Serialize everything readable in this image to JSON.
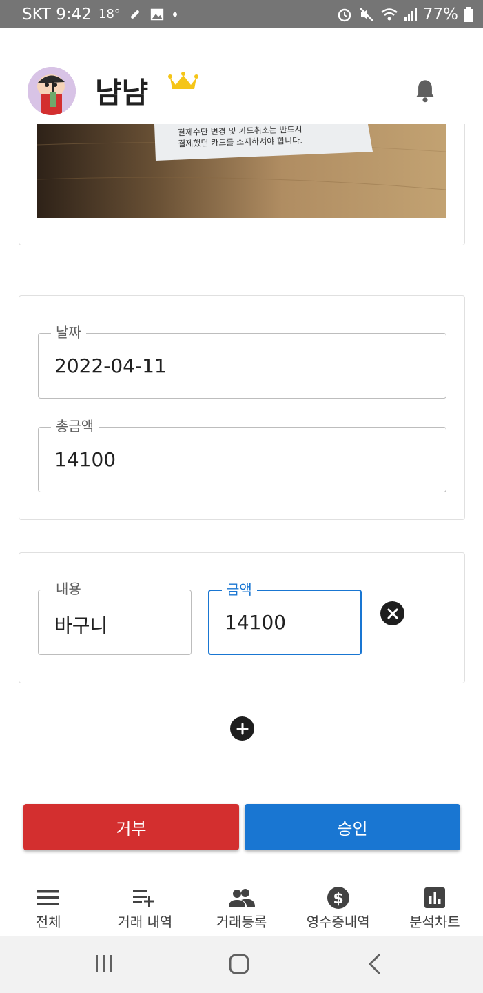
{
  "status_bar": {
    "carrier_time": "SKT 9:42",
    "temp": "18°",
    "battery": "77%"
  },
  "header": {
    "username": "냠냠",
    "avatar_icon": "avatar-cartoon-icon",
    "crown_color": "#f5c518"
  },
  "receipt": {
    "text_line1": "결제수단 변경 및 카드취소는 반드시",
    "text_line2": "결제했던 카드를 소지하셔야 합니다."
  },
  "summary": {
    "date_label": "날짜",
    "date_value": "2022-04-11",
    "total_label": "총금액",
    "total_value": "14100"
  },
  "item": {
    "desc_label": "내용",
    "desc_value": "바구니",
    "amount_label": "금액",
    "amount_value": "14100"
  },
  "actions": {
    "reject": "거부",
    "approve": "승인",
    "reject_color": "#d32f2f",
    "approve_color": "#1976d2"
  },
  "bottom_nav": [
    {
      "label": "전체",
      "icon": "menu-icon"
    },
    {
      "label": "거래 내역",
      "icon": "playlist-add-icon"
    },
    {
      "label": "거래등록",
      "icon": "people-icon"
    },
    {
      "label": "영수증내역",
      "icon": "dollar-icon"
    },
    {
      "label": "분석차트",
      "icon": "bar-chart-icon"
    }
  ]
}
